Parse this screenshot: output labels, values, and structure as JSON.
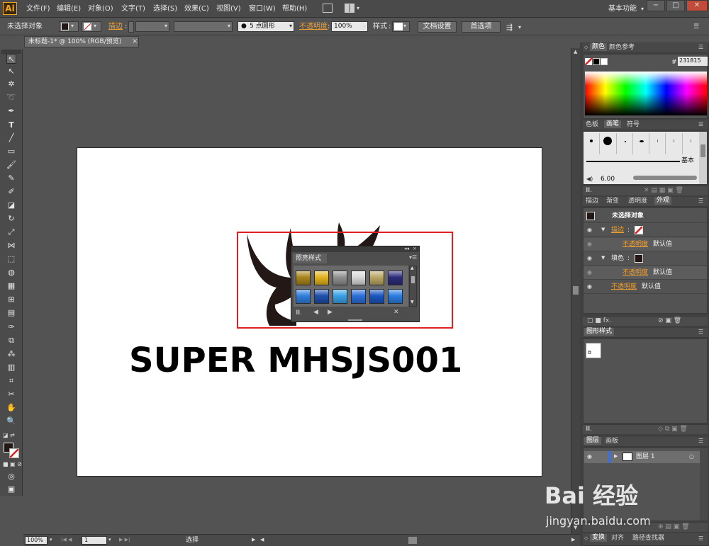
{
  "app": {
    "logo": "Ai"
  },
  "menu": {
    "items": [
      "文件(F)",
      "编辑(E)",
      "对象(O)",
      "文字(T)",
      "选择(S)",
      "效果(C)",
      "视图(V)",
      "窗口(W)",
      "帮助(H)"
    ],
    "workspace": "基本功能",
    "window_buttons": [
      "−",
      "□",
      "✕"
    ]
  },
  "control": {
    "selection_status": "未选择对象",
    "stroke_label": "描边",
    "brush_point": "5 点圆形",
    "opacity_label": "不透明度",
    "opacity_value": "100%",
    "style_label": "样式",
    "doc_setup": "文档设置",
    "preferences": "首选项"
  },
  "document": {
    "tab_title": "未标题-1* @ 100% (RGB/预览)",
    "tab_close": "×"
  },
  "artwork": {
    "text": "SUPER MHSJS001"
  },
  "float_panel": {
    "title": "照亮样式",
    "swatches_row1": [
      "#a8841a",
      "#e1b21c",
      "#8f8f8f",
      "#d8d8d8",
      "#b9a765",
      "#2b2b78"
    ],
    "swatches_row2": [
      "#2f7fdc",
      "#1f4fae",
      "#3aa2e6",
      "#2c6fd8",
      "#1a56c0",
      "#2b7ee0"
    ]
  },
  "status": {
    "zoom": "100%",
    "page": "1",
    "mode": "选择"
  },
  "panels": {
    "color": {
      "tabs": [
        "颜色",
        "颜色参考"
      ],
      "hex_label": "#",
      "hex_value": "231815"
    },
    "brush": {
      "tabs": [
        "色板",
        "画笔",
        "符号"
      ],
      "basic_label": "基本",
      "size_value": "6.00"
    },
    "appearance": {
      "tabs": [
        "描边",
        "渐变",
        "透明度",
        "外观"
      ],
      "header": "未选择对象",
      "stroke_label": "描边",
      "opacity_label": "不透明度",
      "default_value": "默认值",
      "fill_label": "填色"
    },
    "graphic_styles": {
      "tabs": [
        "图形样式"
      ]
    },
    "layers": {
      "tabs": [
        "图层",
        "画板"
      ],
      "layer_name": "图层 1"
    },
    "bottom": {
      "tabs": [
        "变换",
        "对齐",
        "路径查找器"
      ]
    }
  },
  "watermark": {
    "brand": "Bai 经验",
    "url": "jingyan.baidu.com"
  }
}
